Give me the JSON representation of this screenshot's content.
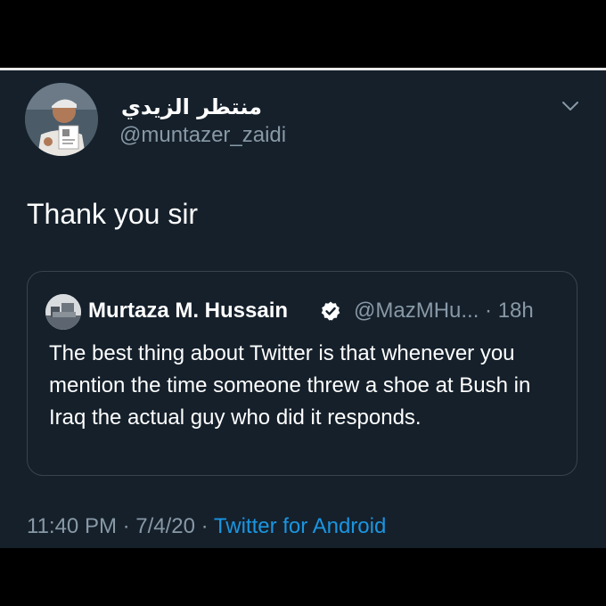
{
  "tweet": {
    "author": {
      "display_name": "منتظر الزيدي",
      "handle": "@muntazer_zaidi"
    },
    "text": "Thank you sir",
    "quoted": {
      "author_name": "Murtaza M. Hussain",
      "handle_and_time": "@MazMHu... · 18h",
      "text": "The best thing about Twitter is that whenever you mention the time someone threw a shoe at Bush in Iraq the actual guy who did it responds."
    },
    "meta": {
      "time_date": "11:40 PM · 7/4/20 · ",
      "source": "Twitter for Android"
    }
  },
  "icons": {
    "menu": "chevron-down-icon",
    "verified": "verified-badge-icon"
  },
  "colors": {
    "background": "#15202b",
    "secondary_text": "#8899a6",
    "link": "#1b95e0",
    "border": "#38444d"
  }
}
